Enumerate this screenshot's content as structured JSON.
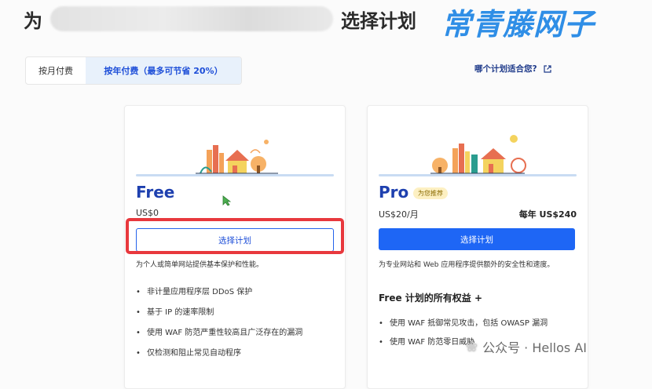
{
  "header": {
    "title_prefix": "为",
    "title_suffix": "选择计划",
    "watermark": "常青藤网子"
  },
  "billing": {
    "monthly_label": "按月付费",
    "yearly_label": "按年付费（最多可节省 20%）"
  },
  "help_link": {
    "label": "哪个计划适合您?"
  },
  "plans": {
    "free": {
      "name": "Free",
      "price": "US$0",
      "cta": "选择计划",
      "description": "为个人或简单网站提供基本保护和性能。",
      "features": [
        "非计量应用程序层 DDoS 保护",
        "基于 IP 的速率限制",
        "使用 WAF 防范严重性较高且广泛存在的漏洞",
        "仅检测和阻止常见自动程序"
      ]
    },
    "pro": {
      "name": "Pro",
      "badge": "为您推荐",
      "price": "US$20/月",
      "yearly_price": "每年 US$240",
      "cta": "选择计划",
      "description": "为专业网站和 Web 应用程序提供额外的安全性和速度。",
      "section_title": "Free 计划的所有权益 +",
      "features": [
        "使用 WAF 抵御常见攻击，包括 OWASP 漏洞",
        "使用 WAF 防范零日威胁"
      ]
    }
  },
  "overlay": {
    "wechat_text": "公众号 · Hellos AI",
    "highlight_color": "#e8383d"
  }
}
